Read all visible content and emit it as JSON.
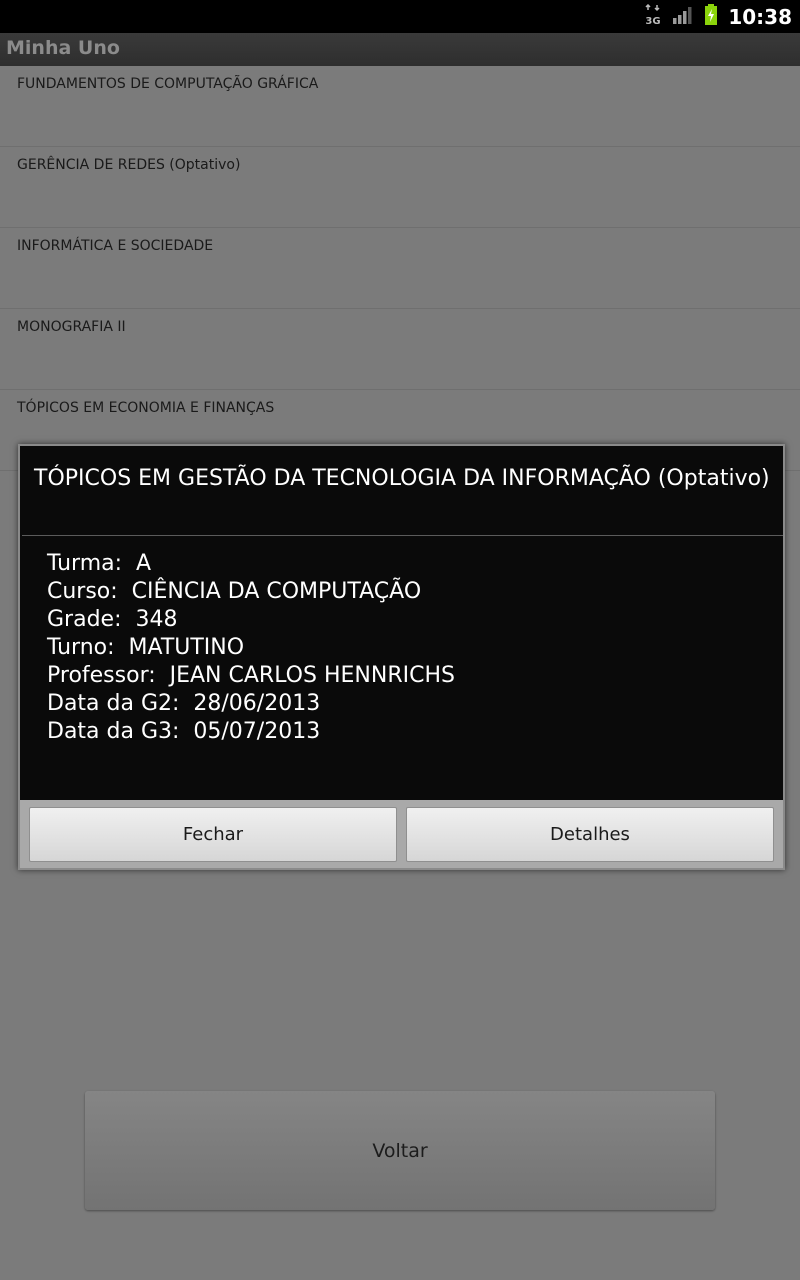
{
  "status_bar": {
    "time": "10:38",
    "network_label": "3G",
    "icons": [
      "3g-data-icon",
      "signal-icon",
      "battery-charging-icon"
    ]
  },
  "app": {
    "title": "Minha Uno"
  },
  "subjects": [
    {
      "label": "FUNDAMENTOS DE COMPUTAÇÃO GRÁFICA"
    },
    {
      "label": "GERÊNCIA DE REDES (Optativo)"
    },
    {
      "label": "INFORMÁTICA E SOCIEDADE"
    },
    {
      "label": "MONOGRAFIA II"
    },
    {
      "label": "TÓPICOS EM ECONOMIA E FINANÇAS"
    }
  ],
  "dialog": {
    "title": " TÓPICOS EM GESTÃO DA TECNOLOGIA DA INFORMAÇÃO (Optativo)",
    "details": [
      {
        "text": "Turma:  A"
      },
      {
        "text": "Curso:  CIÊNCIA DA COMPUTAÇÃO"
      },
      {
        "text": "Grade:  348"
      },
      {
        "text": "Turno:  MATUTINO"
      },
      {
        "text": "Professor:  JEAN CARLOS HENNRICHS"
      },
      {
        "text": "Data da G2:  28/06/2013"
      },
      {
        "text": "Data da G3:  05/07/2013"
      }
    ],
    "buttons": {
      "close": "Fechar",
      "details": "Detalhes"
    }
  },
  "back_button": "Voltar",
  "colors": {
    "status_bar": "#000000",
    "dialog_background": "#0a0a0a",
    "dialog_footer": "#a9a9a9",
    "dimmed_background": "#7b7b7b",
    "battery": "#8bd30b"
  }
}
